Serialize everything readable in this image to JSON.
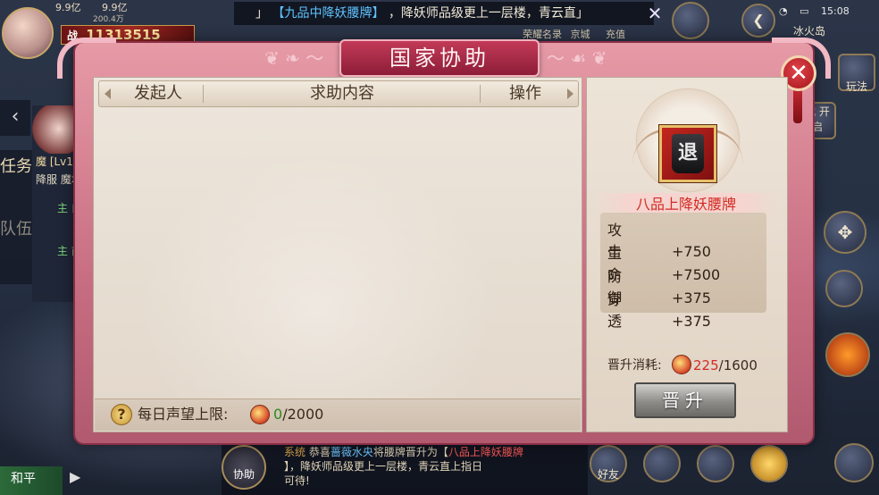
{
  "hud": {
    "resources": [
      "9.9亿",
      "9.9亿"
    ],
    "resource_sub": "200.4万",
    "power_tag": "战",
    "power_value": "11313515",
    "marquee_prefix": "」",
    "marquee_item": "【九品中降妖腰牌】",
    "marquee_rest": "，降妖师品级更上一层楼，青云直」",
    "marquee_close": "✕",
    "clock": "15:08",
    "location": "冰火岛",
    "top_buttons": [
      "荣耀名录",
      "京城",
      "充值"
    ],
    "side_tabs": [
      "任务",
      "队伍"
    ],
    "task_entries": [
      "魔 [Lv1",
      "降服 魔君",
      "主 白泽",
      "主 前往"
    ],
    "right_buttons": [
      "玩法",
      "武 开启"
    ],
    "pk_mode": "和平",
    "assist_label": "协助",
    "friend_label": "好友"
  },
  "chat": {
    "channel": "系统",
    "line1_a": "恭喜",
    "player_name": "蔷薇水央",
    "line1_b": "将腰牌晋升为【",
    "item": "八品上降妖腰牌",
    "line2": "】，降妖师品级更上一层楼，青云直上指日",
    "line3": "可待!"
  },
  "dialog": {
    "title": "国家协助",
    "close_label": "✕",
    "table_headers": {
      "initiator": "发起人",
      "content": "求助内容",
      "action": "操作"
    },
    "rows": [],
    "footer": {
      "help_label": "?",
      "limit_label": "每日声望上限:",
      "current": "0",
      "max": "/2000"
    }
  },
  "item_panel": {
    "icon_glyph": "退",
    "item_name": "八品上降妖腰牌",
    "stats": [
      {
        "key": "攻击",
        "value": "+750"
      },
      {
        "key": "生命",
        "value": "+7500"
      },
      {
        "key": "防御",
        "value": "+375"
      },
      {
        "key": "穿透",
        "value": "+375"
      }
    ],
    "cost_label": "晋升消耗:",
    "cost_current": "225",
    "cost_max": "/1600",
    "upgrade_label": "晋升"
  },
  "colors": {
    "frame_pink": "#c76d82",
    "title_red": "#a82a47",
    "item_name_red": "#d32b24",
    "value_green": "#2b8a1e",
    "close_red": "#c0292f"
  }
}
